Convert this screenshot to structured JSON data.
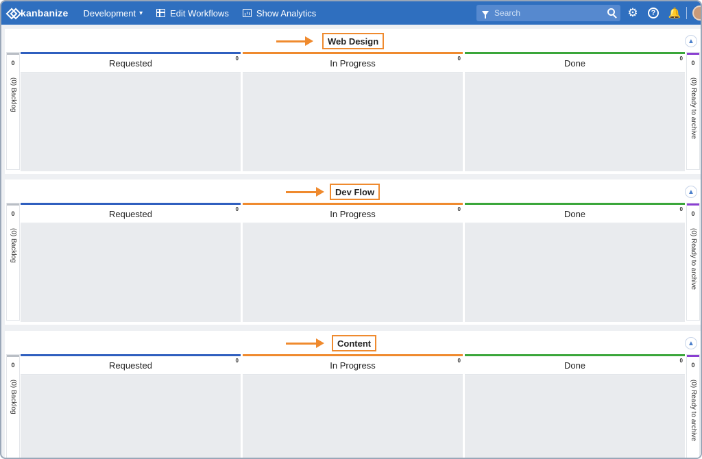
{
  "topbar": {
    "logo": "kanbanize",
    "workspace_label": "Development",
    "edit_workflows": "Edit Workflows",
    "show_analytics": "Show Analytics",
    "search_placeholder": "Search"
  },
  "colors": {
    "topbar": "#2f6fbf",
    "highlight": "#ef8a2e",
    "requested": "#2f5fbf",
    "in_progress": "#ef8a2e",
    "done": "#3aa63a",
    "archive": "#8a3fd1",
    "backlog": "#b9bec5"
  },
  "boards": [
    {
      "title": "Web Design",
      "backlog_count": "0",
      "backlog_label": "(0) Backlog",
      "archive_count": "0",
      "archive_label": "(0) Ready to archive",
      "columns": [
        {
          "label": "Requested",
          "wip": "0"
        },
        {
          "label": "In Progress",
          "wip": "0"
        },
        {
          "label": "Done",
          "wip": "0"
        }
      ]
    },
    {
      "title": "Dev Flow",
      "backlog_count": "0",
      "backlog_label": "(0) Backlog",
      "archive_count": "0",
      "archive_label": "(0) Ready to archive",
      "columns": [
        {
          "label": "Requested",
          "wip": "0"
        },
        {
          "label": "In Progress",
          "wip": "0"
        },
        {
          "label": "Done",
          "wip": "0"
        }
      ]
    },
    {
      "title": "Content",
      "backlog_count": "0",
      "backlog_label": "(0) Backlog",
      "archive_count": "0",
      "archive_label": "(0) Ready to archive",
      "columns": [
        {
          "label": "Requested",
          "wip": "0"
        },
        {
          "label": "In Progress",
          "wip": "0"
        },
        {
          "label": "Done",
          "wip": "0"
        }
      ]
    }
  ]
}
